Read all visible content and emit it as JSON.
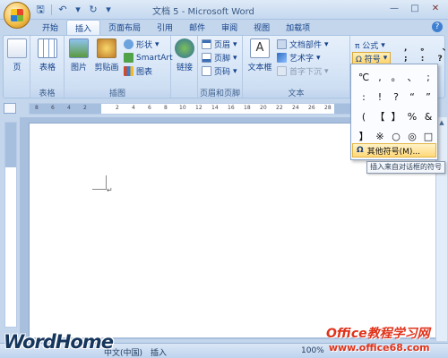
{
  "window": {
    "title": "文档 5 - Microsoft Word",
    "controls": [
      "—",
      "□",
      "✕"
    ]
  },
  "ribbon": {
    "tabs": [
      "开始",
      "插入",
      "页面布局",
      "引用",
      "邮件",
      "审阅",
      "视图",
      "加载项"
    ],
    "active_tab": "插入",
    "groups": {
      "pages": {
        "label": "",
        "button": "页"
      },
      "tables": {
        "label": "表格",
        "button": "表格"
      },
      "illustrations": {
        "label": "插图",
        "picture": "图片",
        "clipart": "剪贴画",
        "shapes": "形状",
        "smartart": "SmartArt",
        "chart": "图表"
      },
      "links": {
        "label": "",
        "button": "链接"
      },
      "header_footer": {
        "label": "页眉和页脚",
        "header": "页眉",
        "footer": "页脚",
        "page_number": "页码"
      },
      "text": {
        "label": "文本",
        "textbox": "文本框",
        "quickparts": "文档部件",
        "wordart": "艺术字",
        "dropcap": "首字下沉"
      },
      "symbols": {
        "equation": "π 公式",
        "symbol": "Ω 符号"
      }
    }
  },
  "ruler": {
    "numbers": [
      "8",
      "6",
      "4",
      "2",
      "2",
      "4",
      "6",
      "8",
      "10",
      "12",
      "14",
      "16",
      "18",
      "20",
      "22",
      "24",
      "26",
      "28"
    ]
  },
  "symbol_dropdown": {
    "symbols": [
      "℃",
      ",",
      "。",
      "、",
      ";",
      ":",
      "!",
      "?",
      "“",
      "”",
      "(",
      "【",
      "】",
      "%",
      "&",
      "】",
      "※",
      "○",
      "◎",
      "□"
    ],
    "more_symbols": "其他符号(M)...",
    "tooltip": "插入来自对话框的符号"
  },
  "statusbar": {
    "language": "中文(中国)",
    "mode": "插入",
    "zoom": "100%"
  },
  "watermark": {
    "left": "WordHome",
    "right_line1": "Office教程学习网",
    "right_line2": "www.office68.com"
  }
}
